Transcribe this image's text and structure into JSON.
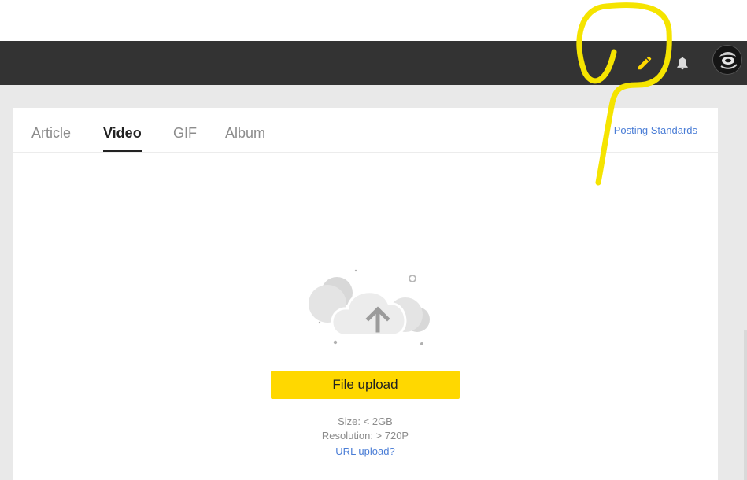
{
  "header": {
    "icons": {
      "edit": "pencil-icon",
      "notifications": "bell-icon"
    },
    "colors": {
      "bar": "#333333",
      "edit_icon": "#ffd800",
      "bell_icon": "#dcdcdc"
    }
  },
  "tabs": [
    {
      "label": "Article",
      "active": false
    },
    {
      "label": "Video",
      "active": true
    },
    {
      "label": "GIF",
      "active": false
    },
    {
      "label": "Album",
      "active": false
    }
  ],
  "posting_standards": "Posting Standards",
  "upload": {
    "button_label": "File upload",
    "size_hint": "Size: < 2GB",
    "resolution_hint": "Resolution: > 720P",
    "url_link": "URL upload?",
    "icon": "cloud-upload-icon",
    "button_color": "#ffd800"
  },
  "annotation": {
    "color": "#f5e400",
    "shape": "freehand-circle-highlighting-edit-icon"
  }
}
